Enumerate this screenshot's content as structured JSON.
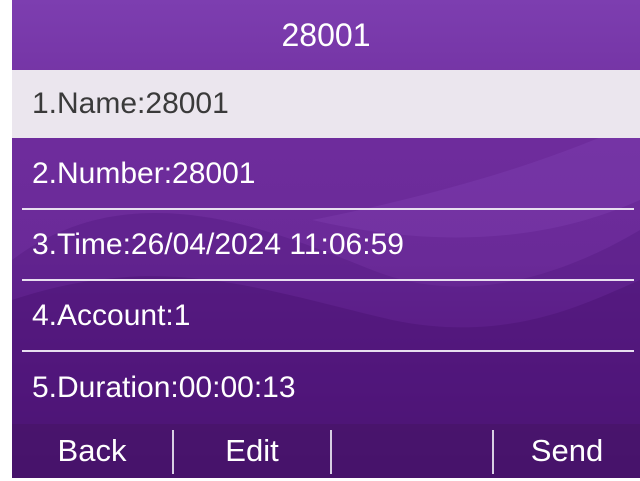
{
  "header": {
    "title": "28001"
  },
  "details": [
    {
      "label": "1.Name:28001",
      "selected": true
    },
    {
      "label": "2.Number:28001",
      "selected": false
    },
    {
      "label": "3.Time:26/04/2024 11:06:59",
      "selected": false
    },
    {
      "label": "4.Account:1",
      "selected": false
    },
    {
      "label": "5.Duration:00:00:13",
      "selected": false
    }
  ],
  "softkeys": {
    "back": "Back",
    "edit": "Edit",
    "empty": "",
    "send": "Send"
  },
  "colors": {
    "background_top": "#7d3eb0",
    "background_bottom": "#3d0a5e",
    "selected_row": "#ebe6ee",
    "text": "#ffffff",
    "selected_text": "#3a3a3a"
  }
}
